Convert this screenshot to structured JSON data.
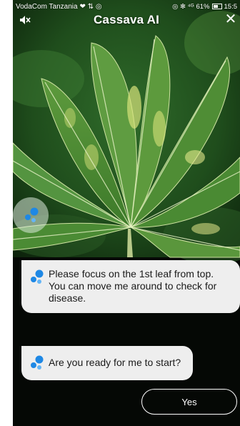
{
  "status_bar": {
    "carrier": "VodaCom Tanzania",
    "carrier_icons": "❤ ⇅ ◎",
    "right_icons": "◎ ✻ ⁴ᴳ",
    "battery": "61%",
    "time": "15:5"
  },
  "header": {
    "title": "Cassava AI",
    "mute_icon": "speaker-muted-icon",
    "close_icon": "close-icon",
    "close_glyph": "✕"
  },
  "chat": {
    "messages": [
      {
        "text": "Please focus on the 1st leaf from top. You can move me around to check for disease."
      },
      {
        "text": "Are you ready for me to start?"
      }
    ],
    "actions": {
      "yes_label": "Yes"
    }
  },
  "colors": {
    "bubble_bg": "#eeeeee",
    "bot_dots": "#1e88e5",
    "bot_dots_light": "#64b5f6",
    "text_light": "#ffffff"
  }
}
